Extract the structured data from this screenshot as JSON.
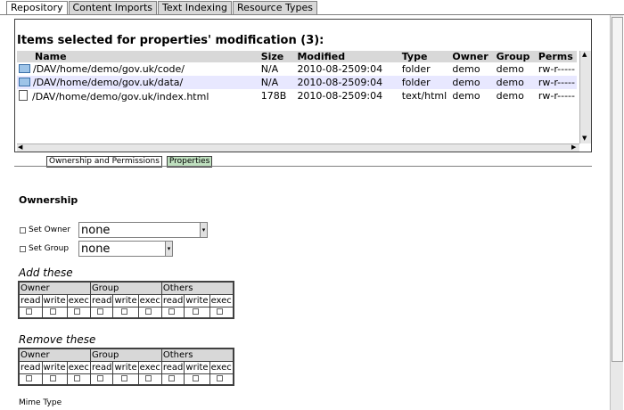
{
  "tabs": [
    "Repository",
    "Content Imports",
    "Text Indexing",
    "Resource Types"
  ],
  "selection": {
    "title": "Items selected for properties' modification (3):",
    "columns": [
      "Name",
      "Size",
      "Modified",
      "Type",
      "Owner",
      "Group",
      "Perms"
    ],
    "rows": [
      {
        "icon": "folder-icon",
        "name": "/DAV/home/demo/gov.uk/code/",
        "size": "N/A",
        "modified": "2010-08-2509:04",
        "type": "folder",
        "owner": "demo",
        "group": "demo",
        "perms": "rw-r-----"
      },
      {
        "icon": "folder-icon",
        "name": "/DAV/home/demo/gov.uk/data/",
        "size": "N/A",
        "modified": "2010-08-2509:04",
        "type": "folder",
        "owner": "demo",
        "group": "demo",
        "perms": "rw-r-----"
      },
      {
        "icon": "file-icon",
        "name": "/DAV/home/demo/gov.uk/index.html",
        "size": "178B",
        "modified": "2010-08-2509:04",
        "type": "text/html",
        "owner": "demo",
        "group": "demo",
        "perms": "rw-r-----"
      }
    ]
  },
  "subtabs": [
    "Ownership and Permissions",
    "Properties"
  ],
  "ownership": {
    "title": "Ownership",
    "set_owner_label": "Set Owner",
    "set_owner_value": "none",
    "set_group_label": "Set Group",
    "set_group_value": "none"
  },
  "permissions": {
    "add_title": "Add these",
    "remove_title": "Remove these",
    "groups": [
      "Owner",
      "Group",
      "Others"
    ],
    "cols": [
      "read",
      "write",
      "exec"
    ]
  },
  "mime_label": "Mime Type"
}
